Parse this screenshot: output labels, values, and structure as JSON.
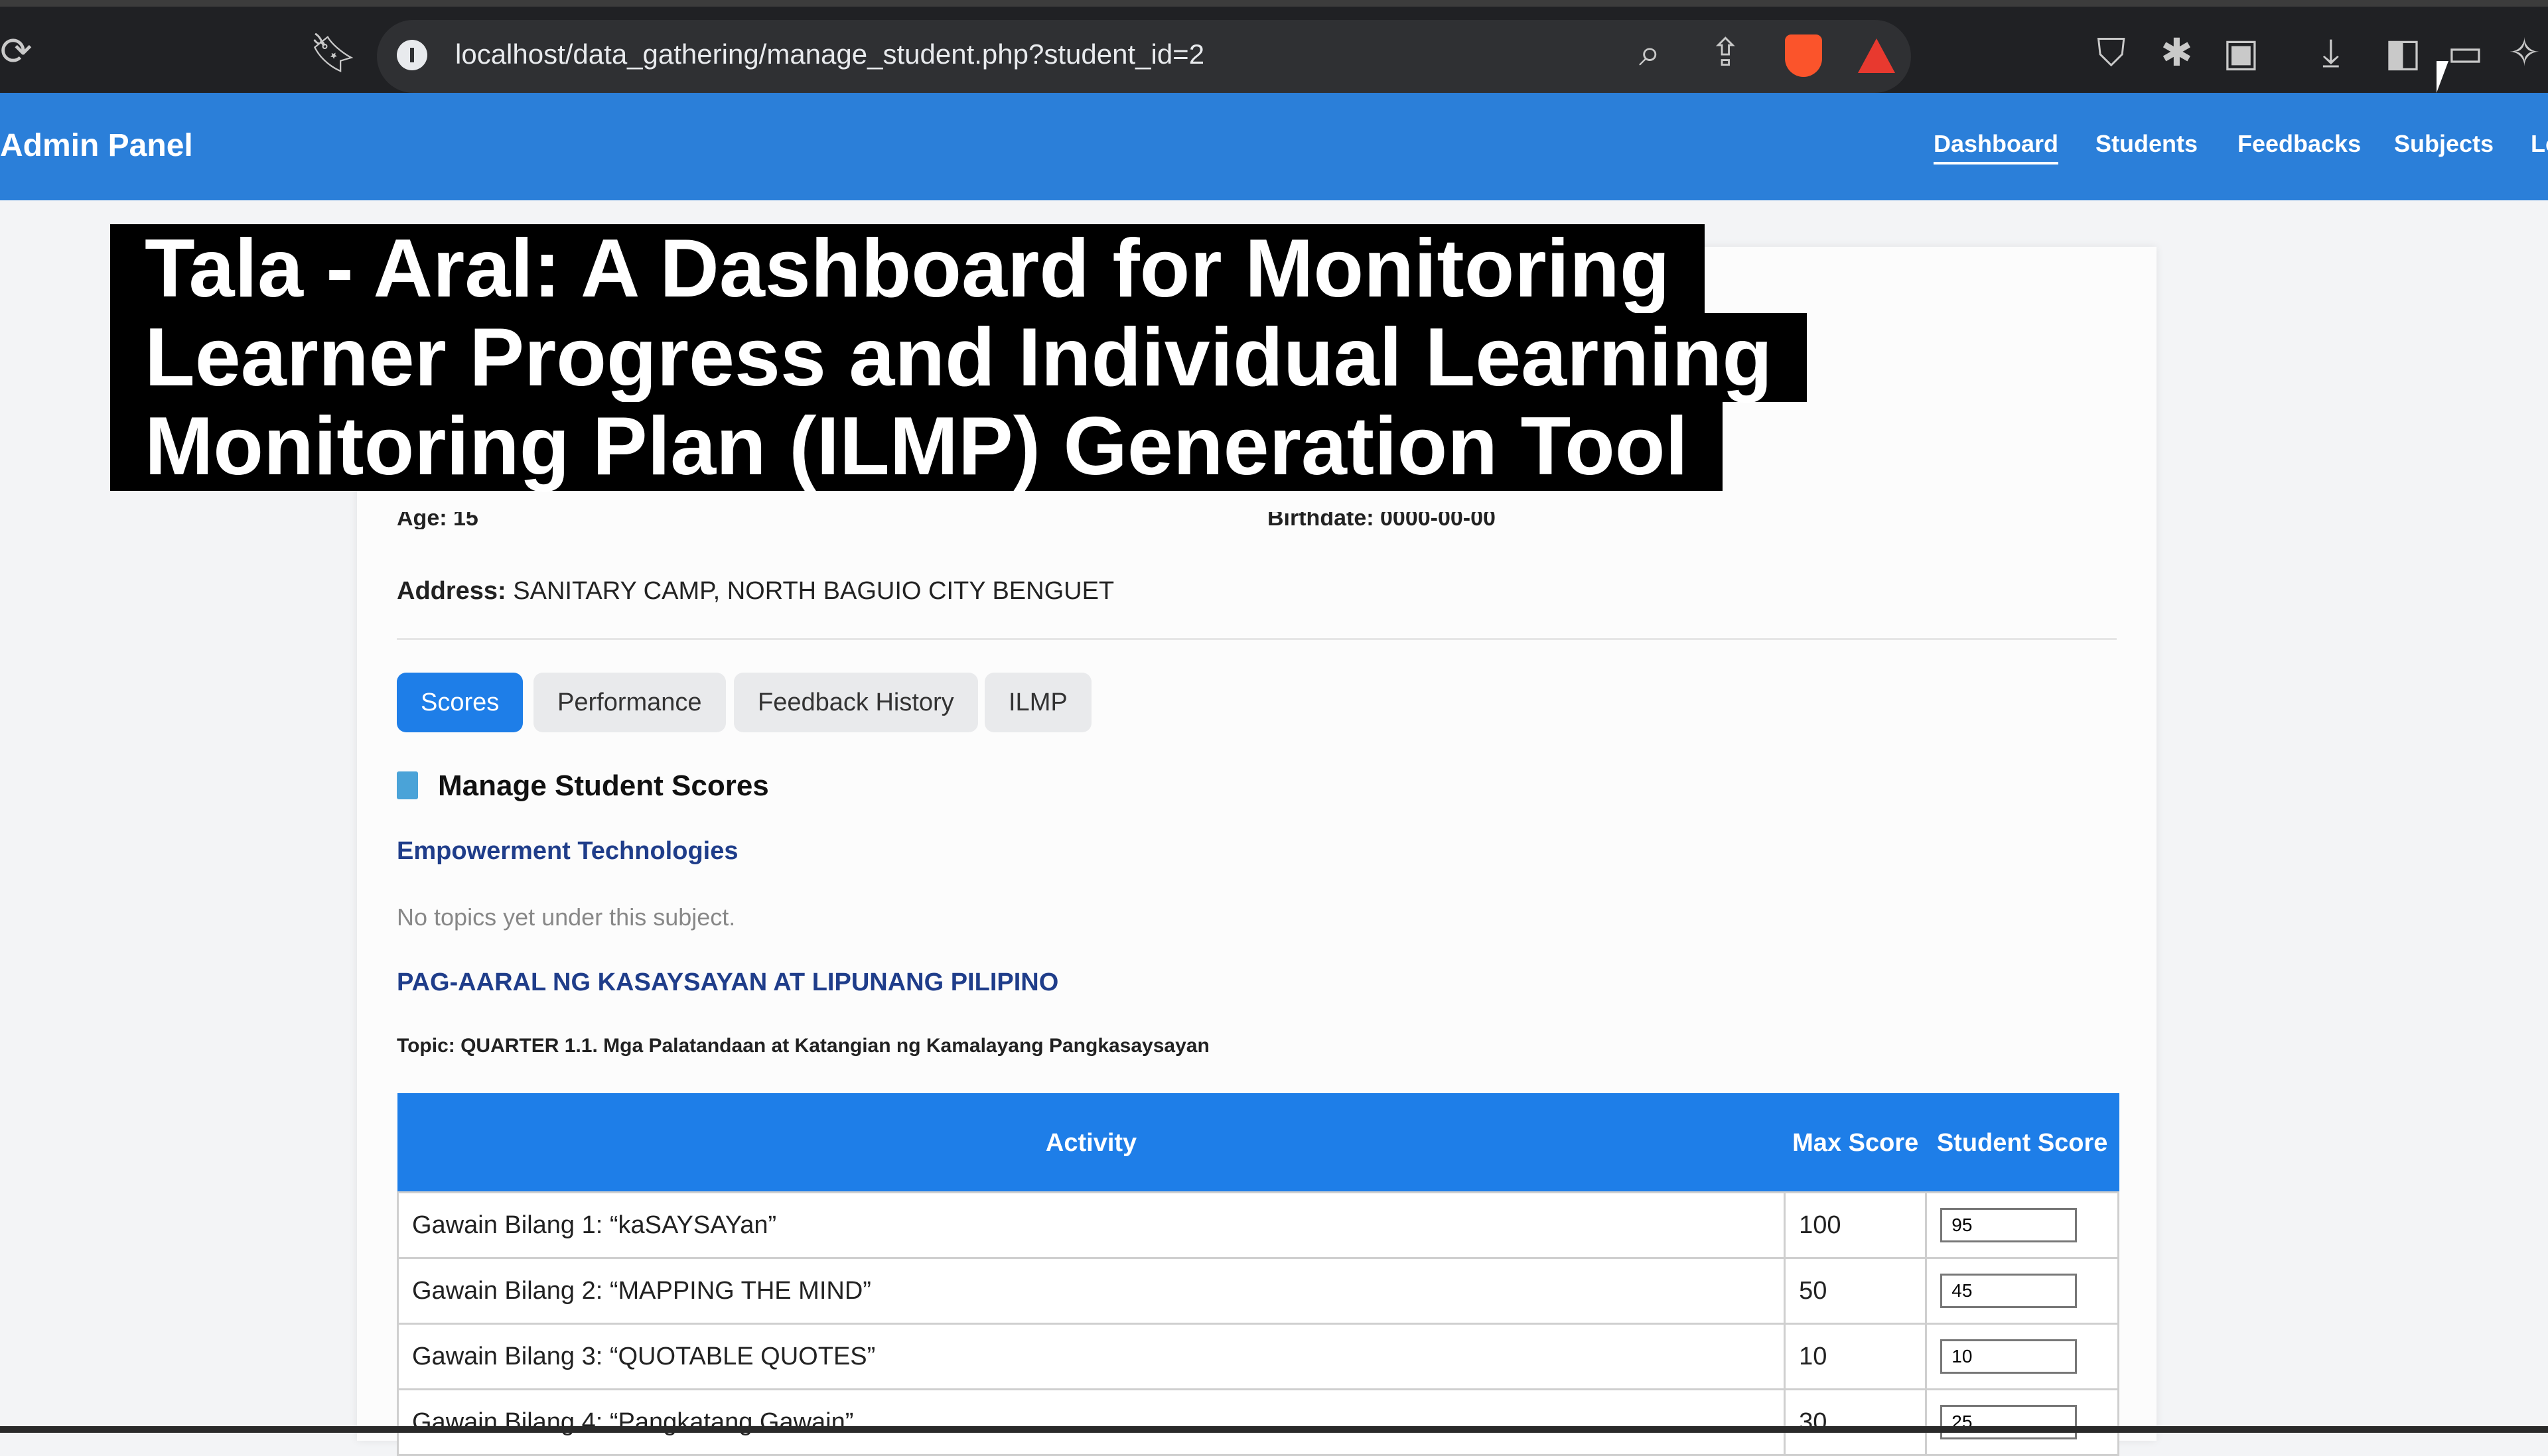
{
  "browser": {
    "url": "localhost/data_gathering/manage_student.php?student_id=2",
    "icons": [
      "reload-icon",
      "bookmark-icon",
      "info-icon",
      "zoom-icon",
      "share-icon",
      "brave-shield-icon",
      "brave-rewards-icon",
      "shield-icon",
      "extensions-icon",
      "tab-search-icon",
      "download-icon",
      "sidebar-icon",
      "wallet-icon",
      "leo-icon"
    ]
  },
  "navbar": {
    "brand": "Admin Panel",
    "links": [
      "Dashboard",
      "Students",
      "Feedbacks",
      "Subjects",
      "Lo"
    ]
  },
  "caption": {
    "line1": "Tala - Aral: A Dashboard for Monitoring",
    "line2": "Learner Progress and Individual Learning",
    "line3": "Monitoring Plan (ILMP) Generation Tool"
  },
  "student": {
    "age_partial": "Age: 15",
    "birthdate_partial": "Birthdate: 0000-00-00",
    "address_label": "Address:",
    "address_value": "SANITARY CAMP, NORTH BAGUIO CITY BENGUET"
  },
  "tabs": [
    "Scores",
    "Performance",
    "Feedback History",
    "ILMP"
  ],
  "manage": {
    "title": "Manage Student Scores",
    "subject1": "Empowerment Technologies",
    "no_topics": "No topics yet under this subject.",
    "subject2": "PAG-AARAL NG KASAYSAYAN AT LIPUNANG PILIPINO",
    "topic": "Topic: QUARTER 1.1. Mga Palatandaan at Katangian ng Kamalayang Pangkasaysayan"
  },
  "table": {
    "headers": [
      "Activity",
      "Max Score",
      "Student Score"
    ],
    "rows": [
      {
        "activity": "Gawain Bilang 1: “kaSAYSAYan”",
        "max": "100",
        "score": "95"
      },
      {
        "activity": "Gawain Bilang 2: “MAPPING THE MIND”",
        "max": "50",
        "score": "45"
      },
      {
        "activity": "Gawain Bilang 3: “QUOTABLE QUOTES”",
        "max": "10",
        "score": "10"
      },
      {
        "activity": "Gawain Bilang 4: “Pangkatang Gawain”",
        "max": "30",
        "score": "25"
      }
    ]
  },
  "colors": {
    "navbar": "#2b7fd9",
    "accent": "#1e7ee8",
    "subject_text": "#1f3d8a"
  }
}
